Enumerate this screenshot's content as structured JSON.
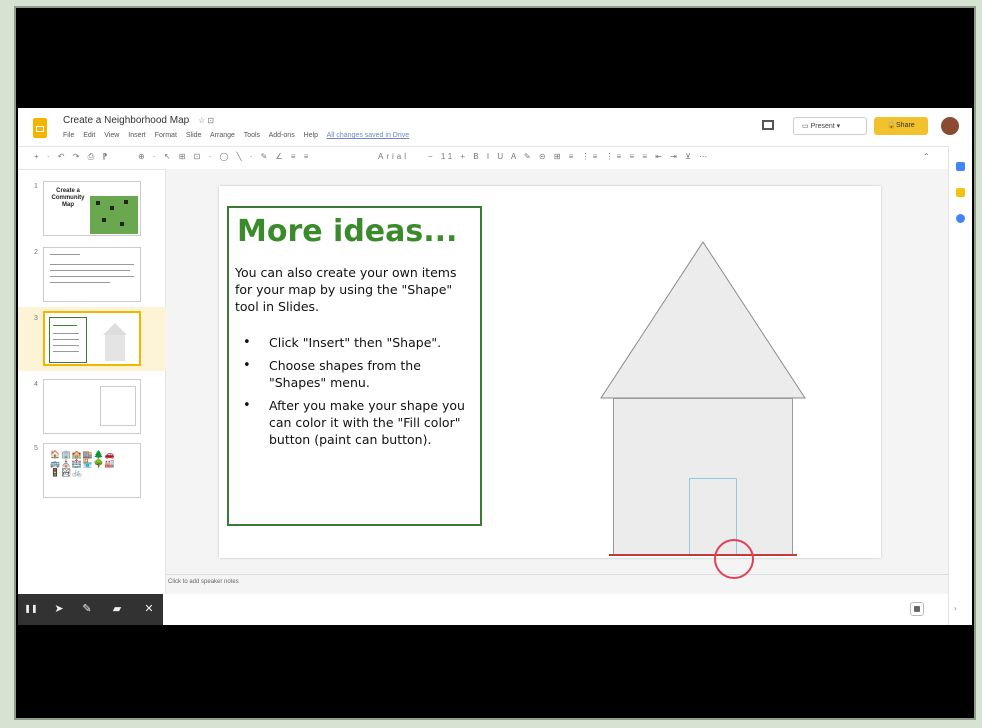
{
  "doc": {
    "title": "Create a Neighborhood Map",
    "title_icons": "☆ ⊡",
    "menu": [
      "File",
      "Edit",
      "View",
      "Insert",
      "Format",
      "Slide",
      "Arrange",
      "Tools",
      "Add-ons",
      "Help"
    ],
    "last_edit": "All changes saved in Drive"
  },
  "header": {
    "present_label": "Present",
    "share_label": "Share"
  },
  "toolbar": {
    "group1": "+ · ↶ ↷ ⎙ ⁋",
    "group2": "⊕ · ↖ ⊞ ⊡ · ◯ ╲ · ✎ ∠ ≡ ≡",
    "font": "Arial",
    "group3": "− 11 + B I U A ✎ ⊝ ⊞ ≡ ⋮≡ ⋮≡ ≡ ≡ ⇤ ⇥ ⊻ ⋯",
    "collapse": "⌃"
  },
  "filmstrip": {
    "numbers": [
      "1",
      "2",
      "3",
      "4",
      "5"
    ],
    "slide1_text": "Create a Community Map",
    "slide5_icons": "🏠🏢🏫🏬🌲🚗🚌⛪🏥🏪🌳🏭🚦🏞🚲"
  },
  "slide": {
    "heading": "More ideas...",
    "intro": "You can also create your own items for your map by using the \"Shape\" tool in Slides.",
    "bullets": [
      "Click \"Insert\" then \"Shape\".",
      "Choose shapes from the \"Shapes\" menu.",
      "After you make your shape you can color it with the \"Fill color\" button (paint can button)."
    ]
  },
  "notes": {
    "placeholder": "Click to add speaker notes"
  },
  "screencast": {
    "icons": [
      "pause-icon",
      "pointer-icon",
      "pen-icon",
      "highlighter-icon",
      "close-icon"
    ],
    "pause": "❚❚",
    "pointer": "➤",
    "pen": "✎",
    "highlighter": "▰",
    "close": "✕"
  },
  "colors": {
    "heading_green": "#3b8a2c",
    "box_border": "#3d7a35",
    "share_yellow": "#f2c12e",
    "cursor_ring": "#e0405a"
  }
}
